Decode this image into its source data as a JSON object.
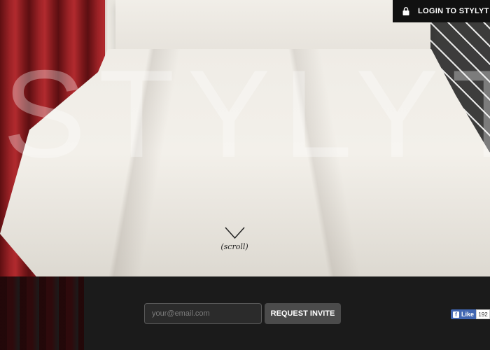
{
  "brand": {
    "hero_title": "STYLYT"
  },
  "header": {
    "login_label": "LOGIN TO STYLYT",
    "login_icon": "lock-icon"
  },
  "hero": {
    "scroll_label": "(scroll)",
    "scroll_icon": "chevron-down-icon"
  },
  "signup": {
    "email_placeholder": "your@email.com",
    "request_label": "REQUEST INVITE"
  },
  "social": {
    "like_label": "Like",
    "like_count": "192"
  },
  "colors": {
    "header_bg": "#111111",
    "footer_bg": "#1b1b1b",
    "facebook": "#4267b2"
  }
}
